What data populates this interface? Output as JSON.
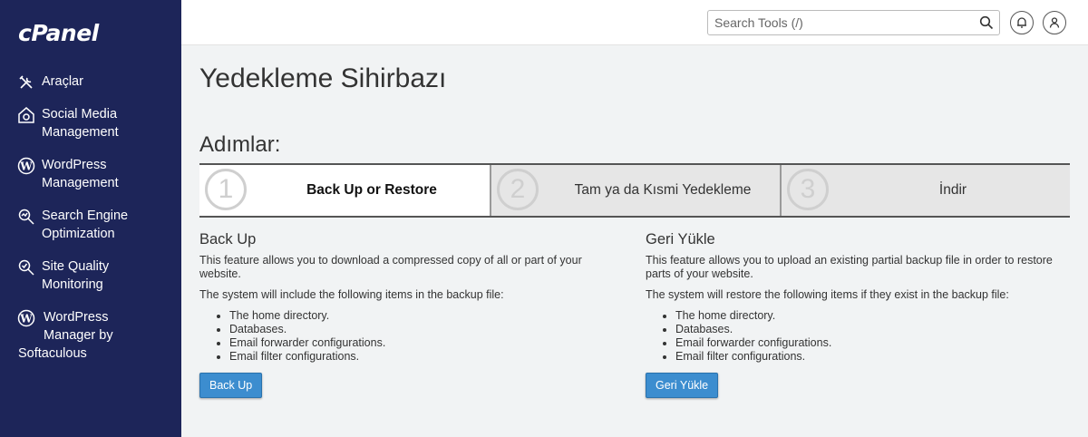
{
  "logo": "cPanel",
  "sidebar": {
    "items": [
      {
        "label": "Araçlar",
        "icon": "tools-icon"
      },
      {
        "label": "Social Media Management",
        "icon": "social-media-icon"
      },
      {
        "label": "WordPress Management",
        "icon": "wordpress-icon"
      },
      {
        "label": "Search Engine Optimization",
        "icon": "seo-icon"
      },
      {
        "label": "Site Quality Monitoring",
        "icon": "site-quality-icon"
      },
      {
        "label_line1": "WordPress",
        "label_line2": "Manager by",
        "label_line3": "Softaculous",
        "icon": "wordpress-icon"
      }
    ]
  },
  "topbar": {
    "search_placeholder": "Search Tools (/)"
  },
  "page": {
    "title": "Yedekleme Sihirbazı",
    "steps_title": "Adımlar:",
    "steps": [
      {
        "number": "1",
        "label": "Back Up or Restore"
      },
      {
        "number": "2",
        "label": "Tam ya da Kısmi Yedekleme"
      },
      {
        "number": "3",
        "label": "İndir"
      }
    ],
    "backup": {
      "heading": "Back Up",
      "desc": "This feature allows you to download a compressed copy of all or part of your website.",
      "list_intro": "The system will include the following items in the backup file:",
      "items": [
        "The home directory.",
        "Databases.",
        "Email forwarder configurations.",
        "Email filter configurations."
      ],
      "button": "Back Up"
    },
    "restore": {
      "heading": "Geri Yükle",
      "desc": "This feature allows you to upload an existing partial backup file in order to restore parts of your website.",
      "list_intro": "The system will restore the following items if they exist in the backup file:",
      "items": [
        "The home directory.",
        "Databases.",
        "Email forwarder configurations.",
        "Email filter configurations."
      ],
      "button": "Geri Yükle"
    }
  },
  "colors": {
    "sidebar_bg": "#1d2559",
    "button_bg": "#3c8dcf",
    "page_bg": "#f1f3f4"
  }
}
